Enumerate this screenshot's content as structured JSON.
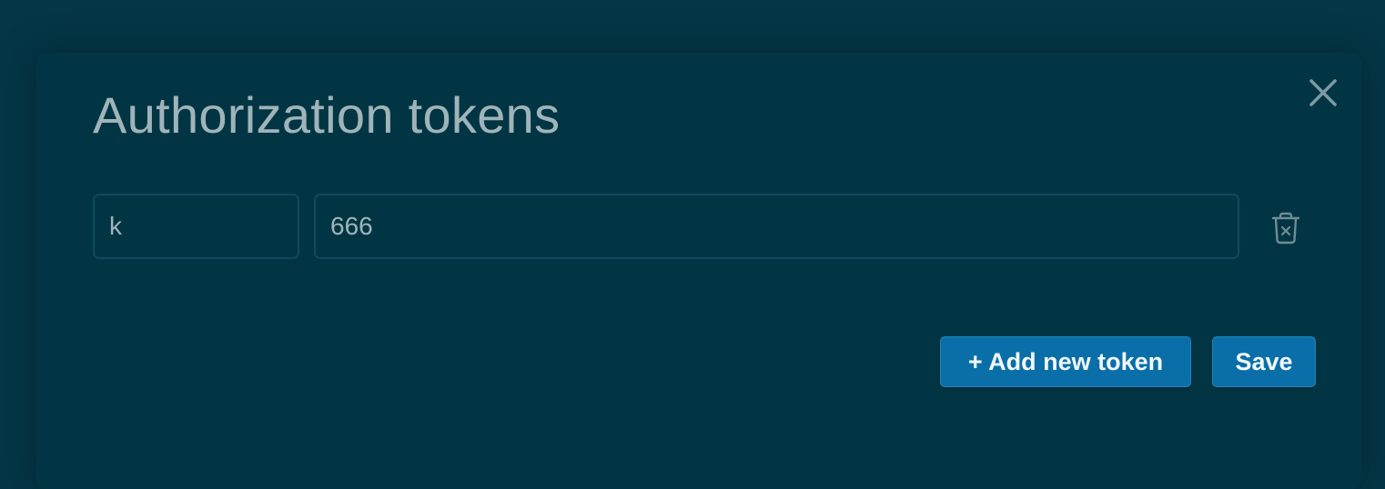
{
  "dialog": {
    "title": "Authorization tokens",
    "close_icon": "close-icon"
  },
  "tokens": [
    {
      "key": "k",
      "value": "666",
      "delete_icon": "trash-icon"
    }
  ],
  "actions": {
    "add_label": "+ Add new token",
    "save_label": "Save"
  },
  "colors": {
    "background": "#043645",
    "dialog": "#023543",
    "title_text": "#9fb4b9",
    "field_border": "#0e4a5c",
    "button": "#0a6fa8",
    "button_text": "#f2f8fb"
  }
}
